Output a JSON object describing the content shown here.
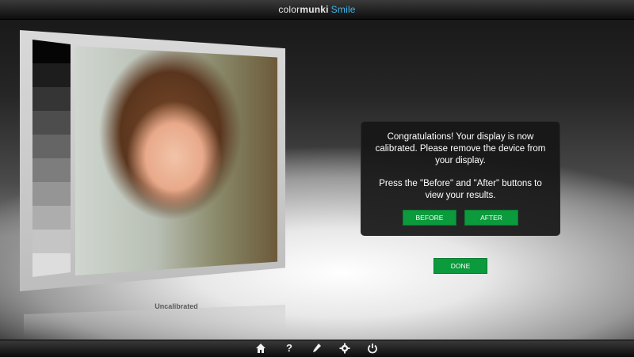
{
  "app": {
    "brand_part1": "color",
    "brand_part2": "munki",
    "brand_part3": "Smile",
    "accent_color": "#3fb6e6"
  },
  "preview": {
    "label": "Uncalibrated"
  },
  "message": {
    "line1": "Congratulations! Your display is now calibrated. Please remove the device from your display.",
    "line2": "Press the \"Before\" and \"After\" buttons to view your results."
  },
  "buttons": {
    "before": "BEFORE",
    "after": "AFTER",
    "done": "DONE",
    "color": "#0b9a3c"
  },
  "toolbar": {
    "icons": [
      "home-icon",
      "help-icon",
      "pen-icon",
      "gear-icon",
      "power-icon"
    ]
  }
}
